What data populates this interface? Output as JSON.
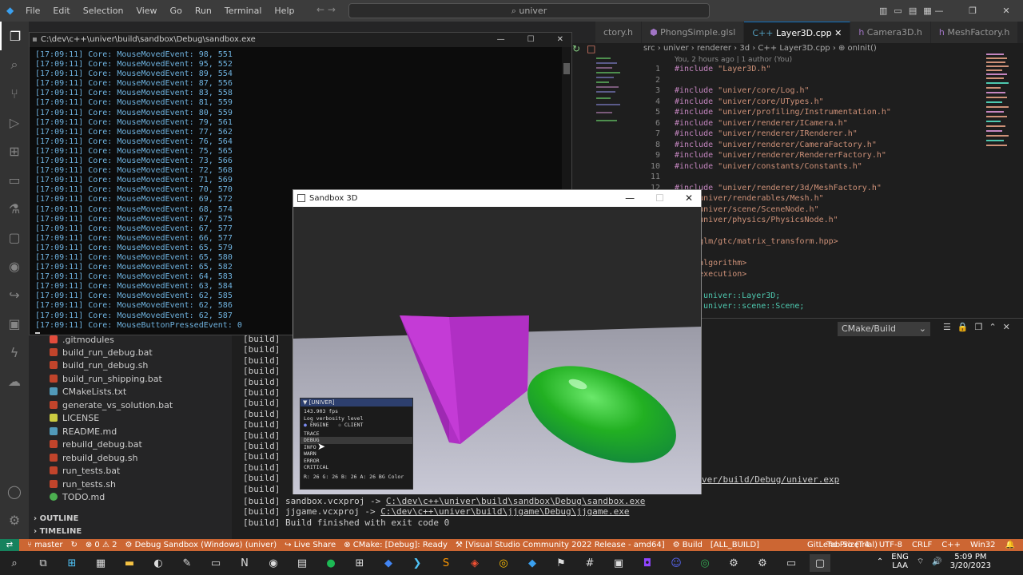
{
  "app": {
    "menu": [
      "File",
      "Edit",
      "Selection",
      "View",
      "Go",
      "Run",
      "Terminal",
      "Help"
    ],
    "search_placeholder": "univer",
    "nav_arrows": "←   →",
    "window_controls": [
      "—",
      "❐",
      "✕"
    ],
    "layout_icons": [
      "▥",
      "▭",
      "▤",
      "▦"
    ]
  },
  "activity_icons": [
    "files-icon",
    "search-icon",
    "source-control-icon",
    "run-debug-icon",
    "extensions-icon",
    "remote-explorer-icon",
    "testing-icon",
    "comments-icon",
    "github-icon",
    "live-share-icon",
    "docker-icon",
    "copilot-icon",
    "gear-icon"
  ],
  "sidebar": {
    "files": [
      {
        "name": ".gitmodules",
        "color": "#e24c3c"
      },
      {
        "name": "build_run_debug.bat",
        "color": "#c1442b"
      },
      {
        "name": "build_run_debug.sh",
        "color": "#c1442b"
      },
      {
        "name": "build_run_shipping.bat",
        "color": "#c1442b"
      },
      {
        "name": "CMakeLists.txt",
        "color": "#519aba"
      },
      {
        "name": "generate_vs_solution.bat",
        "color": "#c1442b"
      },
      {
        "name": "LICENSE",
        "color": "#cbcb41"
      },
      {
        "name": "README.md",
        "color": "#519aba"
      },
      {
        "name": "rebuild_debug.bat",
        "color": "#c1442b"
      },
      {
        "name": "rebuild_debug.sh",
        "color": "#c1442b"
      },
      {
        "name": "run_tests.bat",
        "color": "#c1442b"
      },
      {
        "name": "run_tests.sh",
        "color": "#c1442b"
      },
      {
        "name": "TODO.md",
        "color": "#4caf50"
      }
    ],
    "outline_label": "OUTLINE",
    "timeline_label": "TIMELINE"
  },
  "tabs": [
    {
      "label": "ctory.h",
      "active": false
    },
    {
      "label": "PhongSimple.glsl",
      "active": false
    },
    {
      "label": "Layer3D.cpp",
      "active": true
    },
    {
      "label": "Camera3D.h",
      "active": false
    },
    {
      "label": "MeshFactory.h",
      "active": false
    }
  ],
  "breadcrumb": "src  ›  univer  ›  renderer  ›  3d  ›  C++ Layer3D.cpp  ›  ⊕ onInit()",
  "blame": "You, 2 hours ago | 1 author (You)",
  "code": [
    {
      "n": "1",
      "kw": "#include",
      "str": "\"Layer3D.h\""
    },
    {
      "n": "2",
      "kw": "",
      "str": ""
    },
    {
      "n": "3",
      "kw": "#include",
      "str": "\"univer/core/Log.h\""
    },
    {
      "n": "4",
      "kw": "#include",
      "str": "\"univer/core/UTypes.h\""
    },
    {
      "n": "5",
      "kw": "#include",
      "str": "\"univer/profiling/Instrumentation.h\""
    },
    {
      "n": "6",
      "kw": "#include",
      "str": "\"univer/renderer/ICamera.h\""
    },
    {
      "n": "7",
      "kw": "#include",
      "str": "\"univer/renderer/IRenderer.h\""
    },
    {
      "n": "8",
      "kw": "#include",
      "str": "\"univer/renderer/CameraFactory.h\""
    },
    {
      "n": "9",
      "kw": "#include",
      "str": "\"univer/renderer/RendererFactory.h\""
    },
    {
      "n": "10",
      "kw": "#include",
      "str": "\"univer/constants/Constants.h\""
    },
    {
      "n": "11",
      "kw": "",
      "str": ""
    },
    {
      "n": "12",
      "kw": "#include",
      "str": "\"univer/renderer/3d/MeshFactory.h\""
    },
    {
      "n": "",
      "kw": "ude",
      "str": "\"univer/renderables/Mesh.h\""
    },
    {
      "n": "",
      "kw": "ude",
      "str": "\"univer/scene/SceneNode.h\""
    },
    {
      "n": "",
      "kw": "ude",
      "str": "\"univer/physics/PhysicsNode.h\""
    },
    {
      "n": "",
      "kw": "",
      "str": ""
    },
    {
      "n": "",
      "kw": "ude",
      "str": "<glm/gtc/matrix_transform.hpp>"
    },
    {
      "n": "",
      "kw": "",
      "str": ""
    },
    {
      "n": "",
      "kw": "ude",
      "str": "<algorithm>"
    },
    {
      "n": "",
      "kw": "ude",
      "str": "<execution>"
    },
    {
      "n": "",
      "kw": "",
      "str": ""
    },
    {
      "n": "",
      "kw": "",
      "str": "univer::Layer3D;",
      "ns": true
    },
    {
      "n": "",
      "kw": "",
      "str": "univer::scene::Scene;",
      "ns": true
    }
  ],
  "panel": {
    "dropdown": "CMake/Build",
    "build_prefix": "[build]",
    "build_lines": [
      {
        "text": "[build]",
        "link": ""
      },
      {
        "text": "[build]",
        "link": ""
      },
      {
        "text": "[build]",
        "link": ""
      },
      {
        "text": "[build]",
        "link": ""
      },
      {
        "text": "[build]",
        "link": ""
      },
      {
        "text": "[build]",
        "link": ""
      },
      {
        "text": "[build]",
        "link": ""
      },
      {
        "text": "[build]",
        "link": ""
      },
      {
        "text": "[build]",
        "link": ""
      },
      {
        "text": "[build]",
        "link": ""
      },
      {
        "text": "[build]",
        "link": ""
      },
      {
        "text": "[build]",
        "link": ""
      },
      {
        "text": "[build]",
        "link": ""
      },
      {
        "text": "[build]",
        "link": ""
      },
      {
        "text": "[build]",
        "link": ""
      }
    ],
    "partial_link": "ver/build/Debug/univer.exp",
    "sandbox_line": "[build]   sandbox.vcxproj -> ",
    "sandbox_link": "C:\\dev\\c++\\univer\\build\\sandbox\\Debug\\sandbox.exe",
    "jjgame_line": "[build]   jjgame.vcxproj -> ",
    "jjgame_link": "C:\\dev\\c++\\univer\\build\\jjgame\\Debug\\jjgame.exe",
    "finish_line": "[build] Build finished with exit code 0"
  },
  "console": {
    "title": "C:\\dev\\c++\\univer\\build\\sandbox\\Debug\\sandbox.exe",
    "lines": [
      "[17:09:11] Core: MouseMovedEvent: 98, 551",
      "[17:09:11] Core: MouseMovedEvent: 95, 552",
      "[17:09:11] Core: MouseMovedEvent: 89, 554",
      "[17:09:11] Core: MouseMovedEvent: 87, 556",
      "[17:09:11] Core: MouseMovedEvent: 83, 558",
      "[17:09:11] Core: MouseMovedEvent: 81, 559",
      "[17:09:11] Core: MouseMovedEvent: 80, 559",
      "[17:09:11] Core: MouseMovedEvent: 79, 561",
      "[17:09:11] Core: MouseMovedEvent: 77, 562",
      "[17:09:11] Core: MouseMovedEvent: 76, 564",
      "[17:09:11] Core: MouseMovedEvent: 75, 565",
      "[17:09:11] Core: MouseMovedEvent: 73, 566",
      "[17:09:11] Core: MouseMovedEvent: 72, 568",
      "[17:09:11] Core: MouseMovedEvent: 71, 569",
      "[17:09:11] Core: MouseMovedEvent: 70, 570",
      "[17:09:11] Core: MouseMovedEvent: 69, 572",
      "[17:09:11] Core: MouseMovedEvent: 68, 574",
      "[17:09:11] Core: MouseMovedEvent: 67, 575",
      "[17:09:11] Core: MouseMovedEvent: 67, 577",
      "[17:09:11] Core: MouseMovedEvent: 66, 577",
      "[17:09:11] Core: MouseMovedEvent: 65, 579",
      "[17:09:11] Core: MouseMovedEvent: 65, 580",
      "[17:09:11] Core: MouseMovedEvent: 65, 582",
      "[17:09:11] Core: MouseMovedEvent: 64, 583",
      "[17:09:11] Core: MouseMovedEvent: 63, 584",
      "[17:09:11] Core: MouseMovedEvent: 62, 585",
      "[17:09:11] Core: MouseMovedEvent: 62, 586",
      "[17:09:11] Core: MouseMovedEvent: 62, 587",
      "[17:09:11] Core: MouseButtonPressedEvent: 0"
    ]
  },
  "sandbox": {
    "title": "Sandbox 3D",
    "cube_color": "#b02fc4",
    "ellipsoid_color": "#22b022",
    "imgui": {
      "header": "▼ [UNIVER]",
      "fps": "143.903 fps",
      "verbosity_label": "Log verbosity level",
      "radio_engine": "ENGINE",
      "radio_client": "CLIENT",
      "levels": [
        "TRACE",
        "DEBUG",
        "INFO",
        "WARN",
        "ERROR",
        "CRITICAL"
      ],
      "color_row": "R: 26   G: 26   B: 26   A: 26      BG Color"
    }
  },
  "status": {
    "items": [
      "master",
      "↻",
      "⊗ 0 ⚠ 2",
      "Debug Sandbox (Windows) (univer)",
      "Live Share",
      "CMake: [Debug]: Ready",
      "[Visual Studio Community 2022 Release - amd64]",
      "Build",
      "[ALL_BUILD]",
      "GitLens Pro (Trial)"
    ],
    "right": [
      "Tab Size: 4",
      "UTF-8",
      "CRLF",
      "C++",
      "Win32",
      "🔔"
    ]
  },
  "taskbar": {
    "lang_top": "ENG",
    "lang_bottom": "LAA",
    "time": "5:09 PM",
    "date": "3/20/2023"
  }
}
